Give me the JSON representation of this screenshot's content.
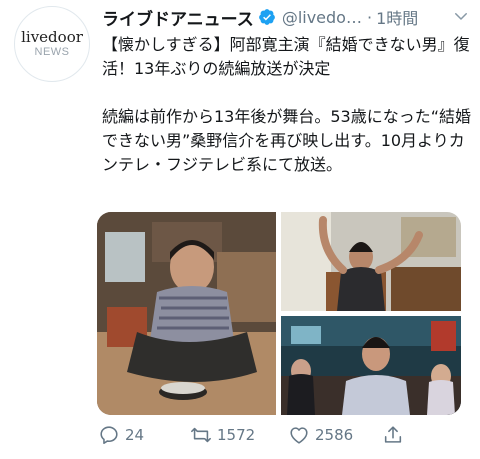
{
  "account": {
    "avatar_text_top": "livedoor",
    "avatar_text_bottom": "NEWS",
    "name": "ライブドアニュース",
    "handle": "@livedo…",
    "separator": "·",
    "time": "1時間"
  },
  "tweet": {
    "paragraph1": "【懐かしすぎる】阿部寛主演『結婚できない男』復活！13年ぶりの続編放送が決定",
    "paragraph2": "続編は前作から13年後が舞台。53歳になった“結婚できない男”桑野信介を再び映し出す。10月よりカンテレ・フジテレビ系にて放送。"
  },
  "actions": {
    "replies": "24",
    "retweets": "1572",
    "likes": "2586"
  },
  "colors": {
    "verified": "#1da1f2",
    "muted": "#657786",
    "text": "#14171a"
  },
  "icons": [
    "verified-badge-icon",
    "chevron-down-icon",
    "reply-icon",
    "retweet-icon",
    "like-icon",
    "share-icon"
  ]
}
